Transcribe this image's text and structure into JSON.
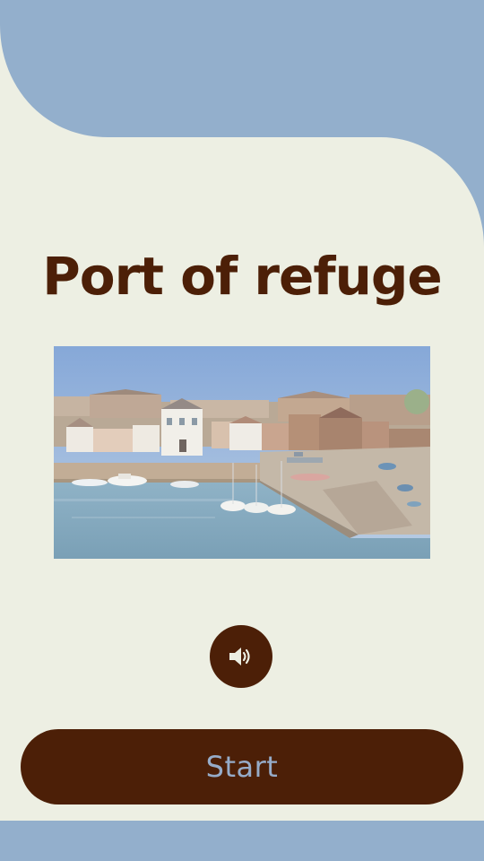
{
  "screen": {
    "title": "Port of refuge",
    "start_label": "Start",
    "photo_alt": "Port of refuge"
  },
  "icons": {
    "sound": "speaker-volume-icon"
  },
  "colors": {
    "sky_blue": "#93afcc",
    "cream": "#edefe3",
    "brown": "#4c1f07",
    "button_text": "#96acc9"
  }
}
